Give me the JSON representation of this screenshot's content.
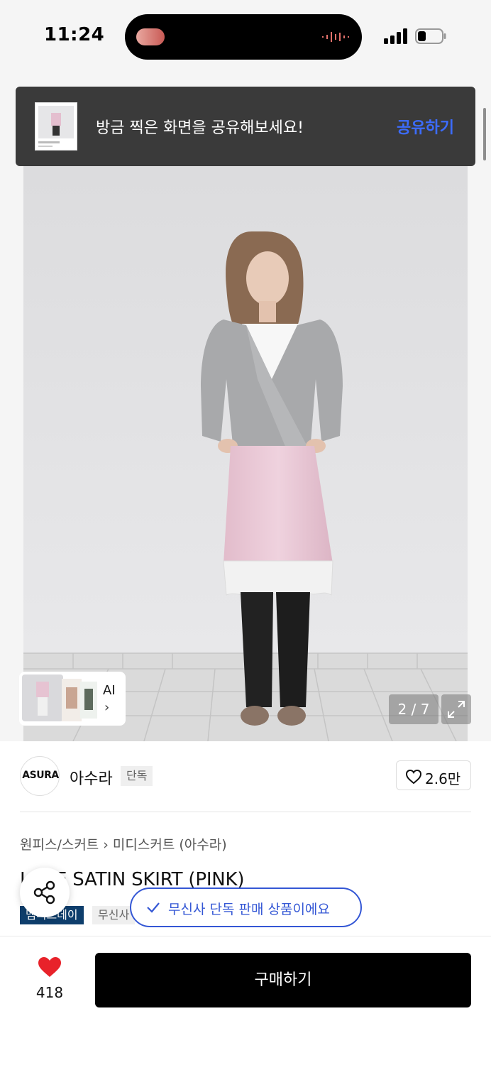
{
  "status_bar": {
    "time": "11:24",
    "icons": [
      "dynamic-island-activity",
      "sound-wave-icon",
      "cellular-signal-icon",
      "battery-icon"
    ]
  },
  "share_toast": {
    "message": "방금 찍은 화면을 공유해보세요!",
    "action": "공유하기"
  },
  "gallery": {
    "counter": "2 / 7",
    "ai_label": "AI",
    "ai_chevron": "›"
  },
  "brand": {
    "logo_text": "ASURA",
    "name": "아수라",
    "tag": "단독",
    "like_count": "2.6만"
  },
  "product": {
    "breadcrumb": [
      "원피스/스커트",
      "미디스커트 (아수라)"
    ],
    "breadcrumb_sep": "›",
    "title": "LACE SATIN SKIRT (PINK)",
    "tags": [
      "멤버스데이",
      "무신사"
    ]
  },
  "exclusive_toast": {
    "message": "무신사 단독 판매 상품이에요"
  },
  "bottom_bar": {
    "wish_count": "418",
    "buy_label": "구매하기"
  },
  "colors": {
    "accent_blue": "#3457d5",
    "toast_action_blue": "#3c6cff",
    "heart_red": "#e8222a",
    "tag_dark": "#0e3e6c",
    "skirt_pink": "#e9c6d4"
  }
}
